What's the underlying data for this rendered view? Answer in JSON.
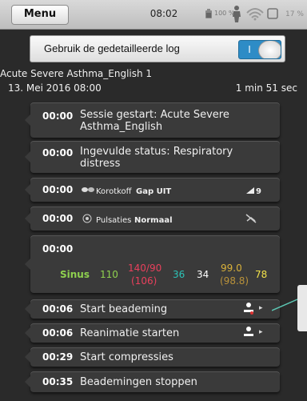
{
  "statusbar": {
    "menu_label": "Menu",
    "time": "08:02",
    "battery_text": "100 %",
    "percent": "17 %"
  },
  "logbar": {
    "label": "Gebruik de gedetailleerde log",
    "toggle_label": "I"
  },
  "scenario": {
    "name": "Acute Severe Asthma_English 1",
    "date": "13. Mei 2016 08:00",
    "duration": "1 min 51 sec"
  },
  "entries": [
    {
      "time": "00:00",
      "text": "Sessie gestart: Acute Severe Asthma_English"
    },
    {
      "time": "00:00",
      "text": "Ingevulde status: Respiratory distress"
    },
    {
      "time": "00:00",
      "label": "Korotkoff",
      "value": "Gap UIT",
      "right": "9"
    },
    {
      "time": "00:00",
      "label": "Pulsaties",
      "value": "Normaal"
    },
    {
      "time": "00:00"
    },
    {
      "time": "00:06",
      "text": "Start beademing"
    },
    {
      "time": "00:06",
      "text": "Reanimatie starten"
    },
    {
      "time": "00:29",
      "text": "Start compressies"
    },
    {
      "time": "00:35",
      "text": "Beademingen stoppen"
    }
  ],
  "vitals": {
    "rhythm": "Sinus",
    "hr": "110",
    "bp": "140/90",
    "map": "(106)",
    "rr": "36",
    "etco2": "34",
    "temp": "99.0",
    "temp_c": "(98.8)",
    "spo2": "78",
    "colors": {
      "rhythm": "#8fd14f",
      "hr": "#8fd14f",
      "bp": "#e8405c",
      "rr": "#2cc3b7",
      "etco2": "#ffffff",
      "temp": "#d9b13a",
      "spo2": "#f2e14a"
    }
  }
}
